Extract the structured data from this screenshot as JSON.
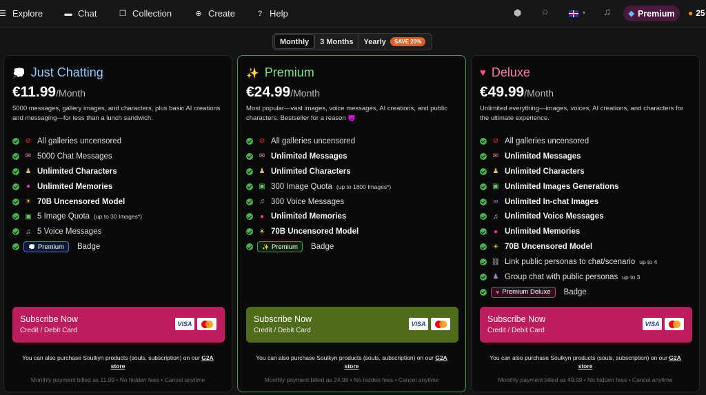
{
  "nav": {
    "items": [
      {
        "label": "Explore",
        "icon": "menu-icon"
      },
      {
        "label": "Chat",
        "icon": "chat-bubble-icon"
      },
      {
        "label": "Collection",
        "icon": "collection-icon"
      },
      {
        "label": "Create",
        "icon": "plus-circle-icon"
      },
      {
        "label": "Help",
        "icon": "help-circle-icon"
      }
    ],
    "premium_label": "Premium",
    "souls_count": "25"
  },
  "billing_toggle": {
    "options": [
      "Monthly",
      "3 Months",
      "Yearly"
    ],
    "selected": "Monthly",
    "save_badge": "SAVE 20%"
  },
  "plans": [
    {
      "title": "Just Chatting",
      "title_color": "#8ec8ff",
      "price": "€11.99",
      "per": "/Month",
      "description": "5000 messages, gallery images, and characters, plus basic AI creations and messaging—for less than a lunch sandwich.",
      "features": [
        {
          "text": "All galleries uncensored",
          "icon": "no-entry-icon"
        },
        {
          "text": "5000 Chat Messages",
          "icon": "mailbox-icon"
        },
        {
          "text": "Unlimited Characters",
          "icon": "person-icon"
        },
        {
          "text": "Unlimited Memories",
          "icon": "brain-icon"
        },
        {
          "text": "70B Uncensored Model",
          "icon": "sun-icon"
        },
        {
          "text": "5 Image Quota",
          "note": "(up to 30 Images*)",
          "icon": "picture-icon"
        },
        {
          "text": "5 Voice Messages",
          "icon": "headphones-icon"
        }
      ],
      "badge": {
        "label": "Premium",
        "suffix": "Badge"
      },
      "subscribe": {
        "title": "Subscribe Now",
        "subtitle": "Credit / Debit Card"
      },
      "g2a": {
        "text": "You can also purchase Soulkyn products (souls, subscription) on our",
        "link": "G2A",
        "link2": "store"
      },
      "billing_note": "Monthly payment billed as 11.99 • No hidden fees • Cancel anytime"
    },
    {
      "title": "Premium",
      "title_color": "#7be38a",
      "price": "€24.99",
      "per": "/Month",
      "description": "Most popular—vast images, voice messages, AI creations, and public characters. Bestseller for a reason 😈",
      "features": [
        {
          "text": "All galleries uncensored",
          "icon": "no-entry-icon"
        },
        {
          "text": "Unlimited Messages",
          "icon": "mailbox-icon"
        },
        {
          "text": "Unlimited Characters",
          "icon": "person-icon"
        },
        {
          "text": "300 Image Quota",
          "note": "(up to 1800 Images*)",
          "icon": "picture-icon"
        },
        {
          "text": "300 Voice Messages",
          "icon": "headphones-icon"
        },
        {
          "text": "Unlimited Memories",
          "icon": "brain-icon"
        },
        {
          "text": "70B Uncensored Model",
          "icon": "sun-icon"
        }
      ],
      "badge": {
        "label": "Premium",
        "suffix": "Badge"
      },
      "subscribe": {
        "title": "Subscribe Now",
        "subtitle": "Credit / Debit Card"
      },
      "g2a": {
        "text": "You can also purchase Soulkyn products (souls, subscription) on our",
        "link": "G2A",
        "link2": "store"
      },
      "billing_note": "Monthly payment billed as 24.99 • No hidden fees • Cancel anytime"
    },
    {
      "title": "Deluxe",
      "title_color": "#ff7aa8",
      "price": "€49.99",
      "per": "/Month",
      "description": "Unlimited everything—images, voices, AI creations, and characters for the ultimate experience.",
      "features": [
        {
          "text": "All galleries uncensored",
          "icon": "no-entry-icon"
        },
        {
          "text": "Unlimited Messages",
          "icon": "mailbox-icon"
        },
        {
          "text": "Unlimited Characters",
          "icon": "person-icon"
        },
        {
          "text": "Unlimited Images Generations",
          "icon": "picture-icon"
        },
        {
          "text": "Unlimited In-chat Images",
          "icon": "infinity-icon"
        },
        {
          "text": "Unlimited Voice Messages",
          "icon": "headphones-icon"
        },
        {
          "text": "Unlimited Memories",
          "icon": "brain-icon"
        },
        {
          "text": "70B Uncensored Model",
          "icon": "sun-icon"
        },
        {
          "text": "Link public personas to chat/scenario",
          "note": "up to 4",
          "icon": "link-icon"
        },
        {
          "text": "Group chat with public personas",
          "note": "up to 3",
          "icon": "group-icon"
        }
      ],
      "badge": {
        "label": "Premium Deluxe",
        "suffix": "Badge"
      },
      "subscribe": {
        "title": "Subscribe Now",
        "subtitle": "Credit / Debit Card"
      },
      "g2a": {
        "text": "You can also purchase Soulkyn products (souls, subscription) on our",
        "link": "G2A",
        "link2": "store"
      },
      "billing_note": "Monthly payment billed as 49.99 • No hidden fees • Cancel anytime"
    }
  ],
  "card_brands": {
    "visa": "VISA"
  }
}
